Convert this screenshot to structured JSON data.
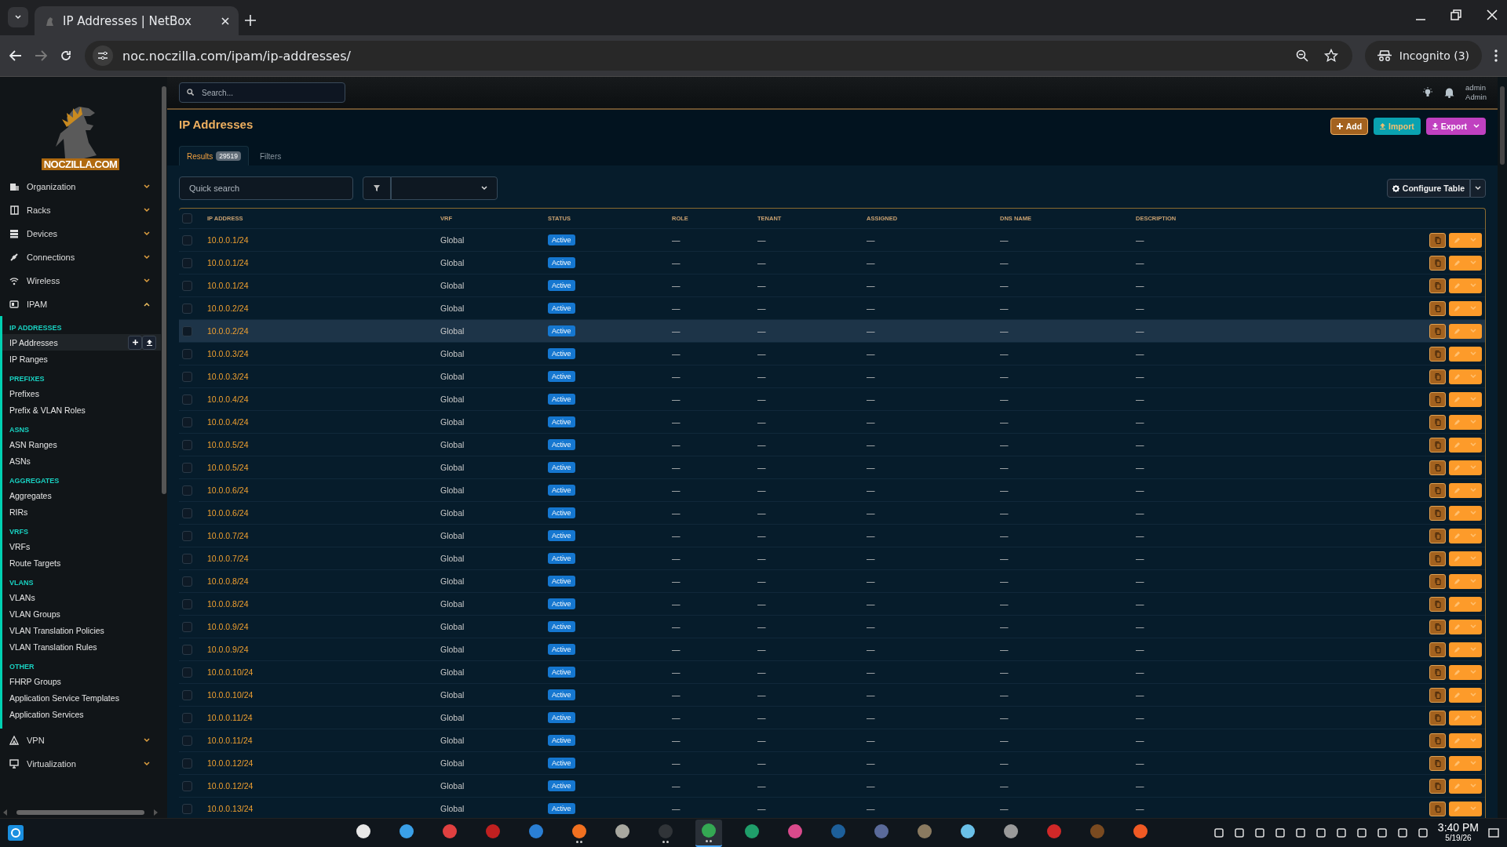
{
  "browser": {
    "tab_title": "IP Addresses | NetBox",
    "url": "noc.noczilla.com/ipam/ip-addresses/",
    "profile": "Incognito (3)"
  },
  "topbar": {
    "search": {
      "placeholder": "Search..."
    },
    "user": "admin",
    "role": "Admin"
  },
  "sidebar": {
    "logo_text": "NOCZILLA.COM",
    "groups": [
      {
        "label": "Organization",
        "expanded": false
      },
      {
        "label": "Racks",
        "expanded": false
      },
      {
        "label": "Devices",
        "expanded": false
      },
      {
        "label": "Connections",
        "expanded": false
      },
      {
        "label": "Wireless",
        "expanded": false
      },
      {
        "label": "IPAM",
        "expanded": true
      }
    ],
    "sections": [
      {
        "heading": "IP ADDRESSES",
        "items": [
          {
            "label": "IP Addresses",
            "selected": true
          },
          {
            "label": "IP Ranges",
            "selected": false
          }
        ]
      },
      {
        "heading": "PREFIXES",
        "items": [
          {
            "label": "Prefixes",
            "selected": false
          },
          {
            "label": "Prefix & VLAN Roles",
            "selected": false
          }
        ]
      },
      {
        "heading": "ASNS",
        "items": [
          {
            "label": "ASN Ranges",
            "selected": false
          },
          {
            "label": "ASNs",
            "selected": false
          }
        ]
      },
      {
        "heading": "AGGREGATES",
        "items": [
          {
            "label": "Aggregates",
            "selected": false
          },
          {
            "label": "RIRs",
            "selected": false
          }
        ]
      },
      {
        "heading": "VRFS",
        "items": [
          {
            "label": "VRFs",
            "selected": false
          },
          {
            "label": "Route Targets",
            "selected": false
          }
        ]
      },
      {
        "heading": "VLANS",
        "items": [
          {
            "label": "VLANs",
            "selected": false
          },
          {
            "label": "VLAN Groups",
            "selected": false
          },
          {
            "label": "VLAN Translation Policies",
            "selected": false
          },
          {
            "label": "VLAN Translation Rules",
            "selected": false
          }
        ]
      },
      {
        "heading": "OTHER",
        "items": [
          {
            "label": "FHRP Groups",
            "selected": false
          },
          {
            "label": "Application Service Templates",
            "selected": false
          },
          {
            "label": "Application Services",
            "selected": false
          }
        ]
      }
    ],
    "bottom_groups": [
      {
        "label": "VPN",
        "expanded": false
      },
      {
        "label": "Virtualization",
        "expanded": false
      }
    ]
  },
  "page": {
    "title": "IP Addresses",
    "buttons": [
      "Add",
      "Import",
      "Export"
    ],
    "tabs": [
      {
        "label": "Results",
        "count": "29519",
        "selected": true
      },
      {
        "label": "Filters",
        "selected": false
      }
    ],
    "quick_search": {
      "placeholder": "Quick search"
    },
    "configure_button": "Configure Table"
  },
  "table": {
    "columns": [
      "IP ADDRESS",
      "VRF",
      "STATUS",
      "ROLE",
      "TENANT",
      "ASSIGNED",
      "DNS NAME",
      "DESCRIPTION"
    ],
    "all_checked": false,
    "rows": [
      {
        "ip": "10.0.0.1/24",
        "vrf": "Global",
        "status": "Active",
        "role": "—",
        "tenant": "—",
        "assigned": "—",
        "dns_name": "—",
        "description": "—",
        "checked": false,
        "highlighted": false
      },
      {
        "ip": "10.0.0.1/24",
        "vrf": "Global",
        "status": "Active",
        "role": "—",
        "tenant": "—",
        "assigned": "—",
        "dns_name": "—",
        "description": "—",
        "checked": false,
        "highlighted": false
      },
      {
        "ip": "10.0.0.1/24",
        "vrf": "Global",
        "status": "Active",
        "role": "—",
        "tenant": "—",
        "assigned": "—",
        "dns_name": "—",
        "description": "—",
        "checked": false,
        "highlighted": false
      },
      {
        "ip": "10.0.0.2/24",
        "vrf": "Global",
        "status": "Active",
        "role": "—",
        "tenant": "—",
        "assigned": "—",
        "dns_name": "—",
        "description": "—",
        "checked": false,
        "highlighted": false
      },
      {
        "ip": "10.0.0.2/24",
        "vrf": "Global",
        "status": "Active",
        "role": "—",
        "tenant": "—",
        "assigned": "—",
        "dns_name": "—",
        "description": "—",
        "checked": false,
        "highlighted": true
      },
      {
        "ip": "10.0.0.3/24",
        "vrf": "Global",
        "status": "Active",
        "role": "—",
        "tenant": "—",
        "assigned": "—",
        "dns_name": "—",
        "description": "—",
        "checked": false,
        "highlighted": false
      },
      {
        "ip": "10.0.0.3/24",
        "vrf": "Global",
        "status": "Active",
        "role": "—",
        "tenant": "—",
        "assigned": "—",
        "dns_name": "—",
        "description": "—",
        "checked": false,
        "highlighted": false
      },
      {
        "ip": "10.0.0.4/24",
        "vrf": "Global",
        "status": "Active",
        "role": "—",
        "tenant": "—",
        "assigned": "—",
        "dns_name": "—",
        "description": "—",
        "checked": false,
        "highlighted": false
      },
      {
        "ip": "10.0.0.4/24",
        "vrf": "Global",
        "status": "Active",
        "role": "—",
        "tenant": "—",
        "assigned": "—",
        "dns_name": "—",
        "description": "—",
        "checked": false,
        "highlighted": false
      },
      {
        "ip": "10.0.0.5/24",
        "vrf": "Global",
        "status": "Active",
        "role": "—",
        "tenant": "—",
        "assigned": "—",
        "dns_name": "—",
        "description": "—",
        "checked": false,
        "highlighted": false
      },
      {
        "ip": "10.0.0.5/24",
        "vrf": "Global",
        "status": "Active",
        "role": "—",
        "tenant": "—",
        "assigned": "—",
        "dns_name": "—",
        "description": "—",
        "checked": false,
        "highlighted": false
      },
      {
        "ip": "10.0.0.6/24",
        "vrf": "Global",
        "status": "Active",
        "role": "—",
        "tenant": "—",
        "assigned": "—",
        "dns_name": "—",
        "description": "—",
        "checked": false,
        "highlighted": false
      },
      {
        "ip": "10.0.0.6/24",
        "vrf": "Global",
        "status": "Active",
        "role": "—",
        "tenant": "—",
        "assigned": "—",
        "dns_name": "—",
        "description": "—",
        "checked": false,
        "highlighted": false
      },
      {
        "ip": "10.0.0.7/24",
        "vrf": "Global",
        "status": "Active",
        "role": "—",
        "tenant": "—",
        "assigned": "—",
        "dns_name": "—",
        "description": "—",
        "checked": false,
        "highlighted": false
      },
      {
        "ip": "10.0.0.7/24",
        "vrf": "Global",
        "status": "Active",
        "role": "—",
        "tenant": "—",
        "assigned": "—",
        "dns_name": "—",
        "description": "—",
        "checked": false,
        "highlighted": false
      },
      {
        "ip": "10.0.0.8/24",
        "vrf": "Global",
        "status": "Active",
        "role": "—",
        "tenant": "—",
        "assigned": "—",
        "dns_name": "—",
        "description": "—",
        "checked": false,
        "highlighted": false
      },
      {
        "ip": "10.0.0.8/24",
        "vrf": "Global",
        "status": "Active",
        "role": "—",
        "tenant": "—",
        "assigned": "—",
        "dns_name": "—",
        "description": "—",
        "checked": false,
        "highlighted": false
      },
      {
        "ip": "10.0.0.9/24",
        "vrf": "Global",
        "status": "Active",
        "role": "—",
        "tenant": "—",
        "assigned": "—",
        "dns_name": "—",
        "description": "—",
        "checked": false,
        "highlighted": false
      },
      {
        "ip": "10.0.0.9/24",
        "vrf": "Global",
        "status": "Active",
        "role": "—",
        "tenant": "—",
        "assigned": "—",
        "dns_name": "—",
        "description": "—",
        "checked": false,
        "highlighted": false
      },
      {
        "ip": "10.0.0.10/24",
        "vrf": "Global",
        "status": "Active",
        "role": "—",
        "tenant": "—",
        "assigned": "—",
        "dns_name": "—",
        "description": "—",
        "checked": false,
        "highlighted": false
      },
      {
        "ip": "10.0.0.10/24",
        "vrf": "Global",
        "status": "Active",
        "role": "—",
        "tenant": "—",
        "assigned": "—",
        "dns_name": "—",
        "description": "—",
        "checked": false,
        "highlighted": false
      },
      {
        "ip": "10.0.0.11/24",
        "vrf": "Global",
        "status": "Active",
        "role": "—",
        "tenant": "—",
        "assigned": "—",
        "dns_name": "—",
        "description": "—",
        "checked": false,
        "highlighted": false
      },
      {
        "ip": "10.0.0.11/24",
        "vrf": "Global",
        "status": "Active",
        "role": "—",
        "tenant": "—",
        "assigned": "—",
        "dns_name": "—",
        "description": "—",
        "checked": false,
        "highlighted": false
      },
      {
        "ip": "10.0.0.12/24",
        "vrf": "Global",
        "status": "Active",
        "role": "—",
        "tenant": "—",
        "assigned": "—",
        "dns_name": "—",
        "description": "—",
        "checked": false,
        "highlighted": false
      },
      {
        "ip": "10.0.0.12/24",
        "vrf": "Global",
        "status": "Active",
        "role": "—",
        "tenant": "—",
        "assigned": "—",
        "dns_name": "—",
        "description": "—",
        "checked": false,
        "highlighted": false
      },
      {
        "ip": "10.0.0.13/24",
        "vrf": "Global",
        "status": "Active",
        "role": "—",
        "tenant": "—",
        "assigned": "—",
        "dns_name": "—",
        "description": "—",
        "checked": false,
        "highlighted": false
      }
    ]
  },
  "taskbar": {
    "apps": [
      {
        "color": "#e8e8e8",
        "running": false,
        "active": false
      },
      {
        "color": "#3aa0e8",
        "running": false,
        "active": false
      },
      {
        "color": "#e04040",
        "running": false,
        "active": false
      },
      {
        "color": "#c02020",
        "running": false,
        "active": false
      },
      {
        "color": "#2a7fd4",
        "running": false,
        "active": false
      },
      {
        "color": "#f07020",
        "running": true,
        "active": false
      },
      {
        "color": "#a8a8a0",
        "running": false,
        "active": false
      },
      {
        "color": "#303438",
        "running": true,
        "active": false
      },
      {
        "color": "#34a853",
        "running": true,
        "active": true
      },
      {
        "color": "#1f9e6a",
        "running": false,
        "active": false
      },
      {
        "color": "#d94a8c",
        "running": false,
        "active": false
      },
      {
        "color": "#1d5f9a",
        "running": false,
        "active": false
      },
      {
        "color": "#5a6a9a",
        "running": false,
        "active": false
      },
      {
        "color": "#8a7a60",
        "running": false,
        "active": false
      },
      {
        "color": "#6ac0e8",
        "running": false,
        "active": false
      },
      {
        "color": "#9a9a9a",
        "running": false,
        "active": false
      },
      {
        "color": "#d02828",
        "running": false,
        "active": false
      },
      {
        "color": "#7a4a20",
        "running": false,
        "active": false
      },
      {
        "color": "#f05a24",
        "running": false,
        "active": false
      }
    ],
    "time": "3:40 PM",
    "date": "5/19/26"
  }
}
